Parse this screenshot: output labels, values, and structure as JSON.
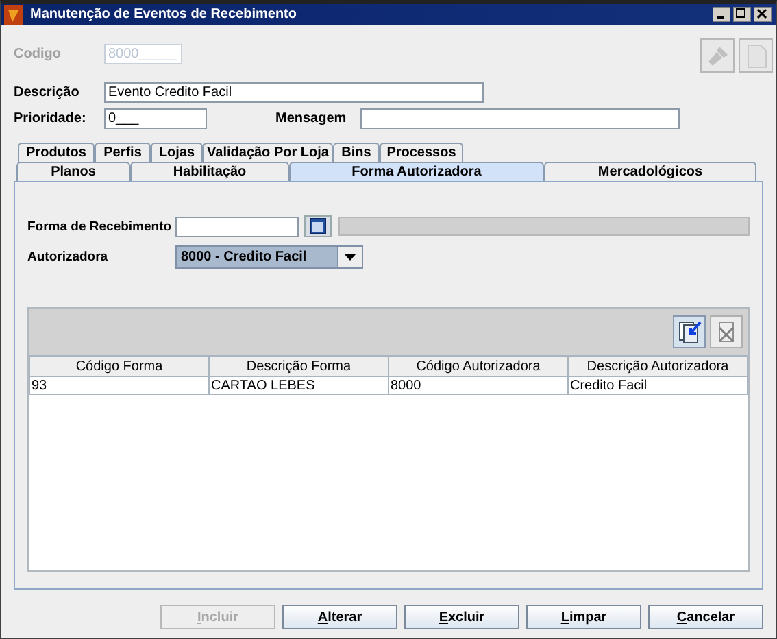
{
  "window": {
    "title": "Manutenção de Eventos de Recebimento"
  },
  "header_fields": [
    {
      "label": "Codigo",
      "value": "8000_____",
      "disabled": true
    },
    {
      "label": "Descrição",
      "value": "Evento Credito Facil",
      "disabled": false
    }
  ],
  "priority_row": [
    {
      "label": "Prioridade:",
      "value": "0___",
      "disabled": false
    },
    {
      "label": "Mensagem",
      "disabled": false
    }
  ],
  "tool_buttons": [
    {
      "kind": "flashlight",
      "disabled": true
    },
    {
      "kind": "document",
      "disabled": true
    }
  ],
  "tab_rows": [
    {
      "tabs": [
        {
          "label": "Produtos",
          "selected": false
        },
        {
          "label": "Perfis",
          "selected": false
        },
        {
          "label": "Lojas",
          "selected": false
        },
        {
          "label": "Validação Por Loja",
          "selected": false
        },
        {
          "label": "Bins",
          "selected": false
        },
        {
          "label": "Processos",
          "selected": false
        }
      ]
    },
    {
      "tabs": [
        {
          "label": "Planos",
          "selected": false
        },
        {
          "label": "Habilitação",
          "selected": false
        },
        {
          "label": "Forma Autorizadora",
          "selected": true
        },
        {
          "label": "Mercadológicos",
          "selected": false
        }
      ]
    }
  ],
  "forma_de_recebimento": {
    "label": "Forma de Recebimento"
  },
  "autorizadora": {
    "label": "Autorizadora",
    "value": "8000 - Credito Facil"
  },
  "grid_buttons": [
    {
      "kind": "add",
      "disabled": false
    },
    {
      "kind": "remove",
      "disabled": true
    }
  ],
  "table": {
    "columns": [
      "Código Forma",
      "Descrição Forma",
      "Código Autorizadora",
      "Descrição Autorizadora"
    ],
    "rows": [
      [
        "93",
        "CARTAO LEBES",
        "8000",
        "Credito Facil"
      ]
    ]
  },
  "buttons": [
    {
      "label": "Incluir",
      "disabled": true,
      "mnemonic": true
    },
    {
      "label": "Alterar",
      "disabled": false,
      "mnemonic": true
    },
    {
      "label": "Excluir",
      "disabled": false,
      "mnemonic": true
    },
    {
      "label": "Limpar",
      "disabled": false,
      "mnemonic": true
    },
    {
      "label": "Cancelar",
      "disabled": false,
      "mnemonic": true
    }
  ]
}
